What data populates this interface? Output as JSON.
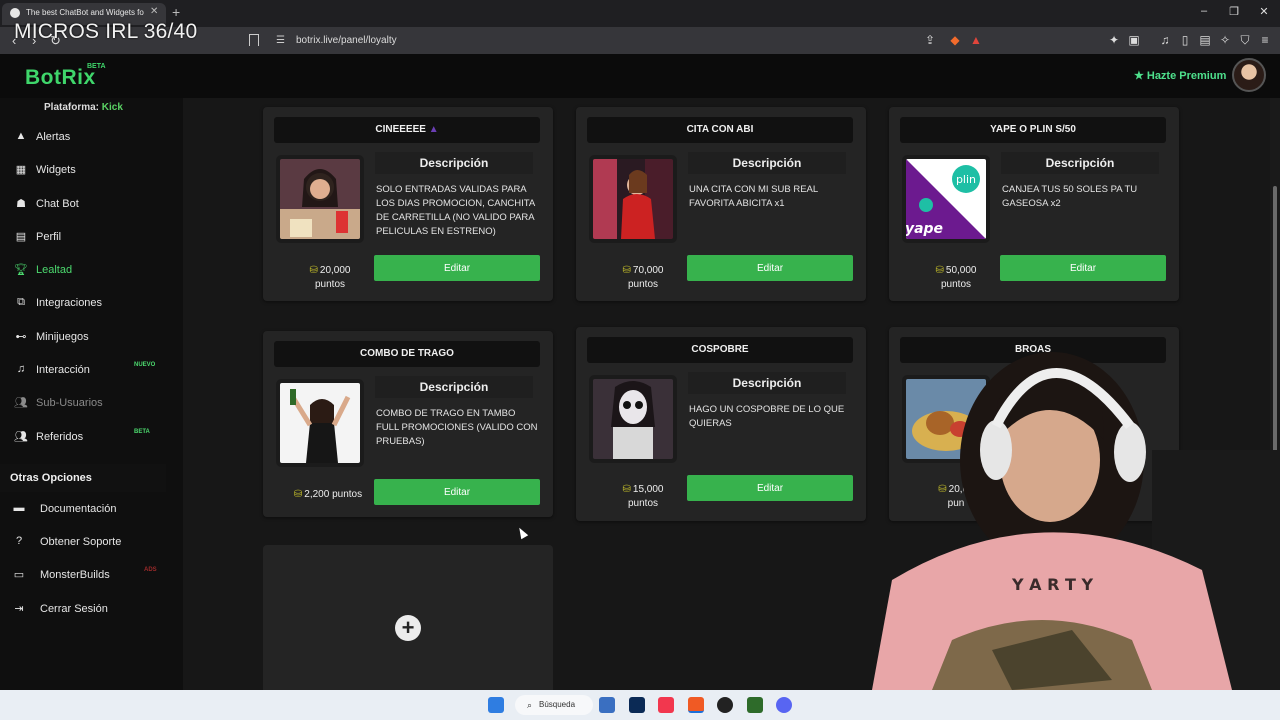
{
  "browser": {
    "tab_title": "The best ChatBot and Widgets fo",
    "url": "botrix.live/panel/loyalty",
    "overlay_text": "MICROS IRL 36/40"
  },
  "header": {
    "logo": "BotRix",
    "logo_badge": "BETA",
    "premium_label": "Hazte Premium"
  },
  "sidebar": {
    "platform_label": "Plataforma:",
    "platform_value": "Kick",
    "items": [
      {
        "label": "Alertas",
        "icon": "warning-icon"
      },
      {
        "label": "Widgets",
        "icon": "grid-icon"
      },
      {
        "label": "Chat Bot",
        "icon": "robot-icon"
      },
      {
        "label": "Perfil",
        "icon": "id-card-icon"
      },
      {
        "label": "Lealtad",
        "icon": "trophy-icon"
      },
      {
        "label": "Integraciones",
        "icon": "plug-icon"
      },
      {
        "label": "Minijuegos",
        "icon": "gamepad-icon"
      },
      {
        "label": "Interacción",
        "icon": "music-icon",
        "badge": "NUEVO"
      },
      {
        "label": "Sub-Usuarios",
        "icon": "users-icon"
      },
      {
        "label": "Referidos",
        "icon": "users-icon",
        "badge": "BETA"
      }
    ],
    "section_title": "Otras Opciones",
    "other_items": [
      {
        "label": "Documentación",
        "icon": "book-icon"
      },
      {
        "label": "Obtener Soporte",
        "icon": "help-icon"
      },
      {
        "label": "MonsterBuilds",
        "icon": "monitor-icon",
        "badge": "ADS"
      },
      {
        "label": "Cerrar Sesión",
        "icon": "logout-icon"
      }
    ]
  },
  "rewards": {
    "desc_heading": "Descripción",
    "edit_label": "Editar",
    "cards": [
      {
        "title": "CINEEEEE",
        "description": "SOLO ENTRADAS VALIDAS PARA LOS DIAS PROMOCION, CANCHITA DE CARRETILLA (NO VALIDO PARA PELICULAS EN ESTRENO)",
        "points": "20,000",
        "unit": "puntos"
      },
      {
        "title": "CITA CON ABI",
        "description": "UNA CITA CON MI SUB REAL FAVORITA ABICITA x1",
        "points": "70,000",
        "unit": "puntos"
      },
      {
        "title": "YAPE O PLIN S/50",
        "description": "CANJEA TUS 50 SOLES PA TU GASEOSA x2",
        "points": "50,000",
        "unit": "puntos"
      },
      {
        "title": "COMBO DE TRAGO",
        "description": "COMBO DE TRAGO EN TAMBO FULL PROMOCIONES (VALIDO CON PRUEBAS)",
        "points": "2,200 puntos",
        "unit": ""
      },
      {
        "title": "COSPOBRE",
        "description": "HAGO UN COSPOBRE DE LO QUE QUIERAS",
        "points": "15,000",
        "unit": "puntos"
      },
      {
        "title": "BROAS",
        "description": "",
        "points": "20,00",
        "unit": "pun"
      }
    ]
  },
  "taskbar": {
    "search_label": "Búsqueda"
  },
  "colors": {
    "brand_green": "#3fd66b",
    "button_green": "#37b24d",
    "coin": "#c7c12a"
  }
}
